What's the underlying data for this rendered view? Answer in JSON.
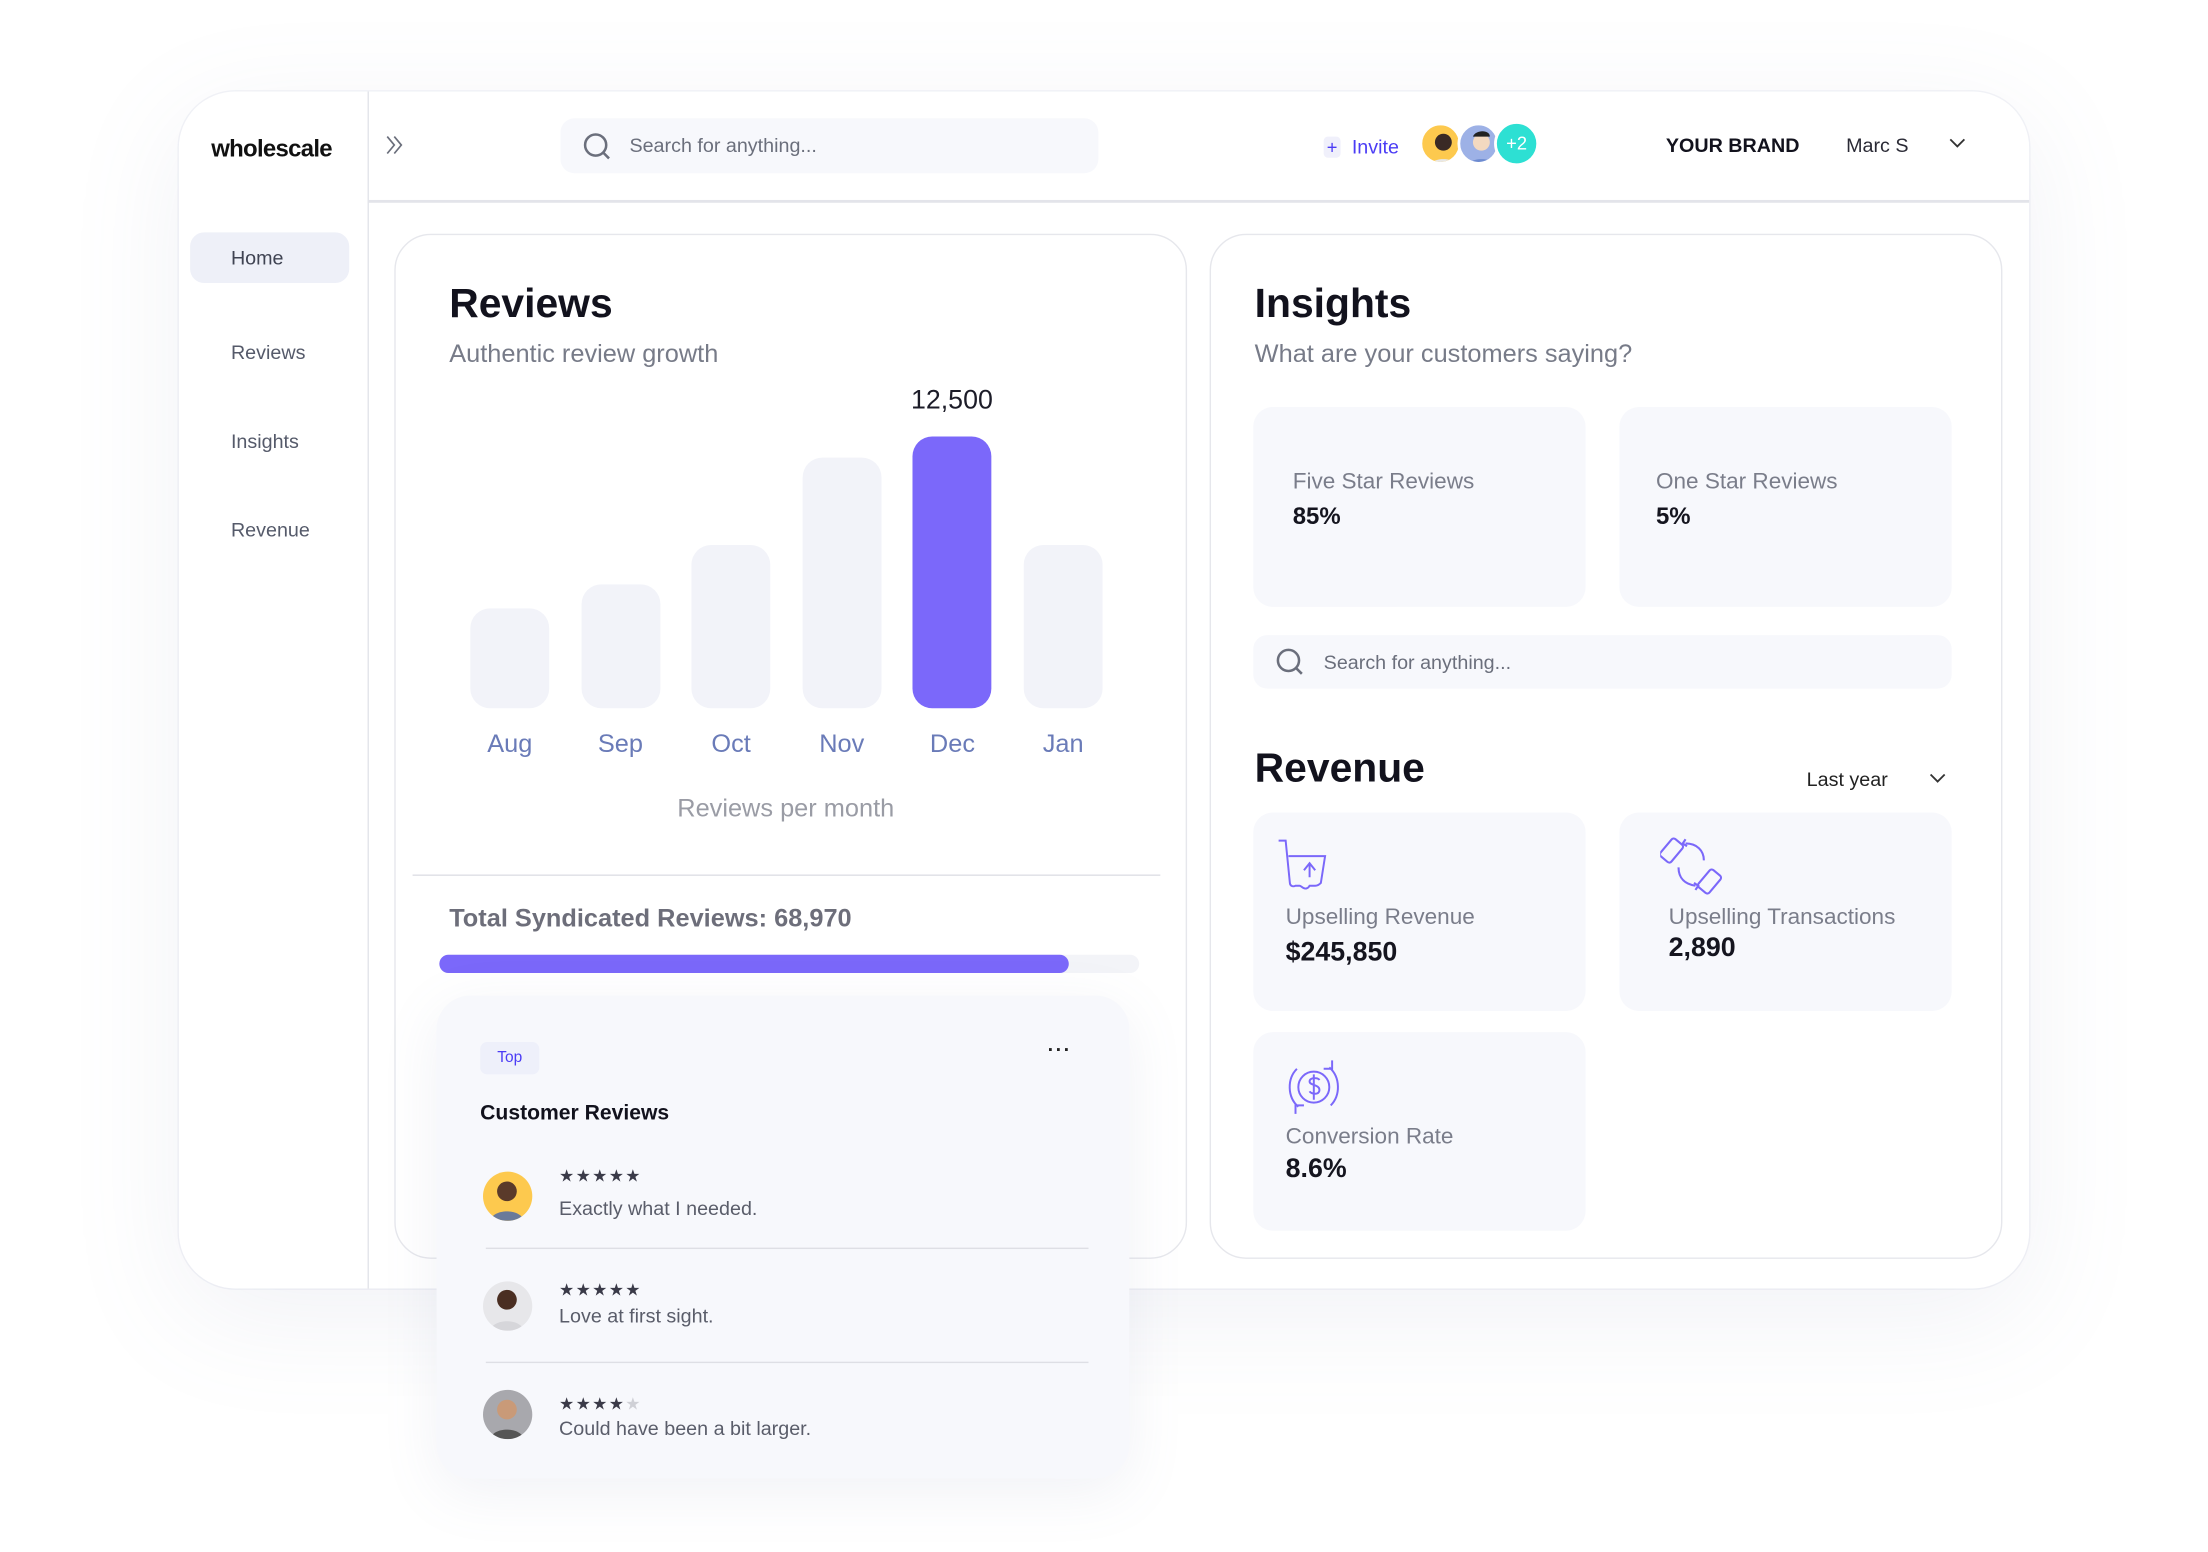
{
  "brand": {
    "logo": "wholescale"
  },
  "sidebar": {
    "items": [
      {
        "label": "Home",
        "active": true
      },
      {
        "label": "Reviews"
      },
      {
        "label": "Insights"
      },
      {
        "label": "Revenue"
      }
    ]
  },
  "header": {
    "search_placeholder": "Search for anything...",
    "invite_label": "Invite",
    "invite_icon": "plus-icon",
    "team_extra": "+2",
    "brand_label": "YOUR BRAND",
    "user_name": "Marc S"
  },
  "colors": {
    "accent": "#7b68fa",
    "invite": "#4b3cf5",
    "teal": "#2de0d3",
    "bar_inactive": "#f2f3f9"
  },
  "reviews": {
    "title": "Reviews",
    "subtitle": "Authentic review growth",
    "peak_label": "12,500",
    "caption": "Reviews per month",
    "total_label": "Total Syndicated Reviews: 68,970",
    "progress": 0.9
  },
  "chart_data": {
    "type": "bar",
    "categories": [
      "Aug",
      "Sep",
      "Oct",
      "Nov",
      "Dec",
      "Jan"
    ],
    "values": [
      4600,
      5700,
      7500,
      11500,
      12500,
      7500
    ],
    "highlight": "Dec",
    "data_labels": {
      "Dec": "12,500"
    },
    "xlabel": "Reviews per month",
    "ylim": [
      0,
      12500
    ],
    "grid": false
  },
  "customer_reviews": {
    "badge": "Top",
    "title": "Customer Reviews",
    "items": [
      {
        "rating": 5,
        "text": "Exactly what I needed."
      },
      {
        "rating": 5,
        "text": "Love at first sight."
      },
      {
        "rating": 4,
        "text": "Could have been a bit larger."
      }
    ]
  },
  "insights": {
    "title": "Insights",
    "subtitle": "What are your customers saying?",
    "stats": [
      {
        "label": "Five Star Reviews",
        "value": "85%"
      },
      {
        "label": "One Star Reviews",
        "value": "5%"
      }
    ],
    "search_placeholder": "Search for anything..."
  },
  "revenue": {
    "title": "Revenue",
    "period": "Last year",
    "stats": [
      {
        "label": "Upselling Revenue",
        "value": "$245,850",
        "icon": "cart-upload-icon"
      },
      {
        "label": "Upselling Transactions",
        "value": "2,890",
        "icon": "card-exchange-icon"
      },
      {
        "label": "Conversion Rate",
        "value": "8.6%",
        "icon": "dollar-cycle-icon"
      }
    ]
  }
}
